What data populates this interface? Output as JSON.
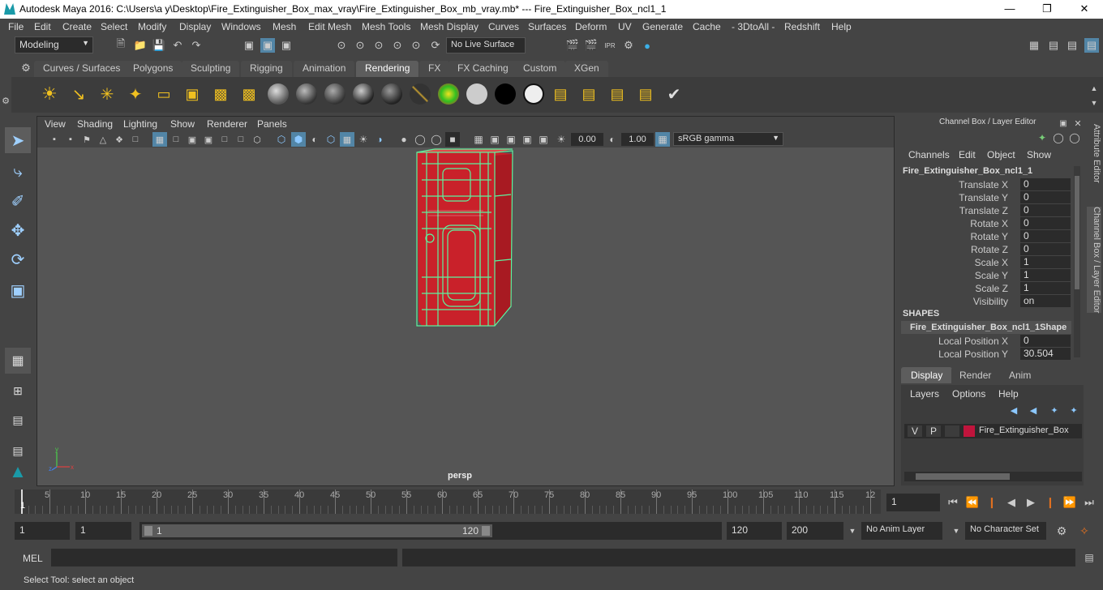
{
  "window": {
    "title": "Autodesk Maya 2016: C:\\Users\\a y\\Desktop\\Fire_Extinguisher_Box_max_vray\\Fire_Extinguisher_Box_mb_vray.mb*   ---   Fire_Extinguisher_Box_ncl1_1"
  },
  "menubar": [
    "File",
    "Edit",
    "Create",
    "Select",
    "Modify",
    "Display",
    "Windows",
    "Mesh",
    "Edit Mesh",
    "Mesh Tools",
    "Mesh Display",
    "Curves",
    "Surfaces",
    "Deform",
    "UV",
    "Generate",
    "Cache",
    "- 3DtoAll -",
    "Redshift",
    "Help"
  ],
  "status": {
    "mode": "Modeling",
    "live_surface": "No Live Surface"
  },
  "shelf_tabs": [
    "Curves / Surfaces",
    "Polygons",
    "Sculpting",
    "Rigging",
    "Animation",
    "Rendering",
    "FX",
    "FX Caching",
    "Custom",
    "XGen"
  ],
  "shelf_active": "Rendering",
  "viewport": {
    "menu": [
      "View",
      "Shading",
      "Lighting",
      "Show",
      "Renderer",
      "Panels"
    ],
    "exposure": "0.00",
    "gamma": "1.00",
    "color_space": "sRGB gamma",
    "camera": "persp"
  },
  "channel_box": {
    "title": "Channel Box / Layer Editor",
    "menu": [
      "Channels",
      "Edit",
      "Object",
      "Show"
    ],
    "object": "Fire_Extinguisher_Box_ncl1_1",
    "attrs": [
      {
        "label": "Translate X",
        "value": "0"
      },
      {
        "label": "Translate Y",
        "value": "0"
      },
      {
        "label": "Translate Z",
        "value": "0"
      },
      {
        "label": "Rotate X",
        "value": "0"
      },
      {
        "label": "Rotate Y",
        "value": "0"
      },
      {
        "label": "Rotate Z",
        "value": "0"
      },
      {
        "label": "Scale X",
        "value": "1"
      },
      {
        "label": "Scale Y",
        "value": "1"
      },
      {
        "label": "Scale Z",
        "value": "1"
      },
      {
        "label": "Visibility",
        "value": "on"
      }
    ],
    "shapes_header": "SHAPES",
    "shape_name": "Fire_Extinguisher_Box_ncl1_1Shape",
    "shape_attrs": [
      {
        "label": "Local Position X",
        "value": "0"
      },
      {
        "label": "Local Position Y",
        "value": "30.504"
      }
    ]
  },
  "layer_editor": {
    "tabs": [
      "Display",
      "Render",
      "Anim"
    ],
    "menu": [
      "Layers",
      "Options",
      "Help"
    ],
    "layer": {
      "v": "V",
      "p": "P",
      "name": "Fire_Extinguisher_Box",
      "color": "#c0143c"
    }
  },
  "side_tabs": [
    "Attribute Editor",
    "Channel Box / Layer Editor"
  ],
  "timeline": {
    "ticks": [
      "1",
      "5",
      "10",
      "15",
      "20",
      "25",
      "30",
      "35",
      "40",
      "45",
      "50",
      "55",
      "60",
      "65",
      "70",
      "75",
      "80",
      "85",
      "90",
      "95",
      "100",
      "105",
      "110",
      "115",
      "12"
    ],
    "current": "1"
  },
  "range": {
    "start": "1",
    "anim_start": "1",
    "slider_start": "1",
    "slider_end": "120",
    "end": "120",
    "anim_end": "200",
    "anim_layer": "No Anim Layer",
    "char_set": "No Character Set"
  },
  "cmd": {
    "label": "MEL"
  },
  "help": "Select Tool: select an object",
  "colors": {
    "accent": "#5285a6",
    "wire": "#5cf5a0",
    "box": "#d2232a"
  }
}
